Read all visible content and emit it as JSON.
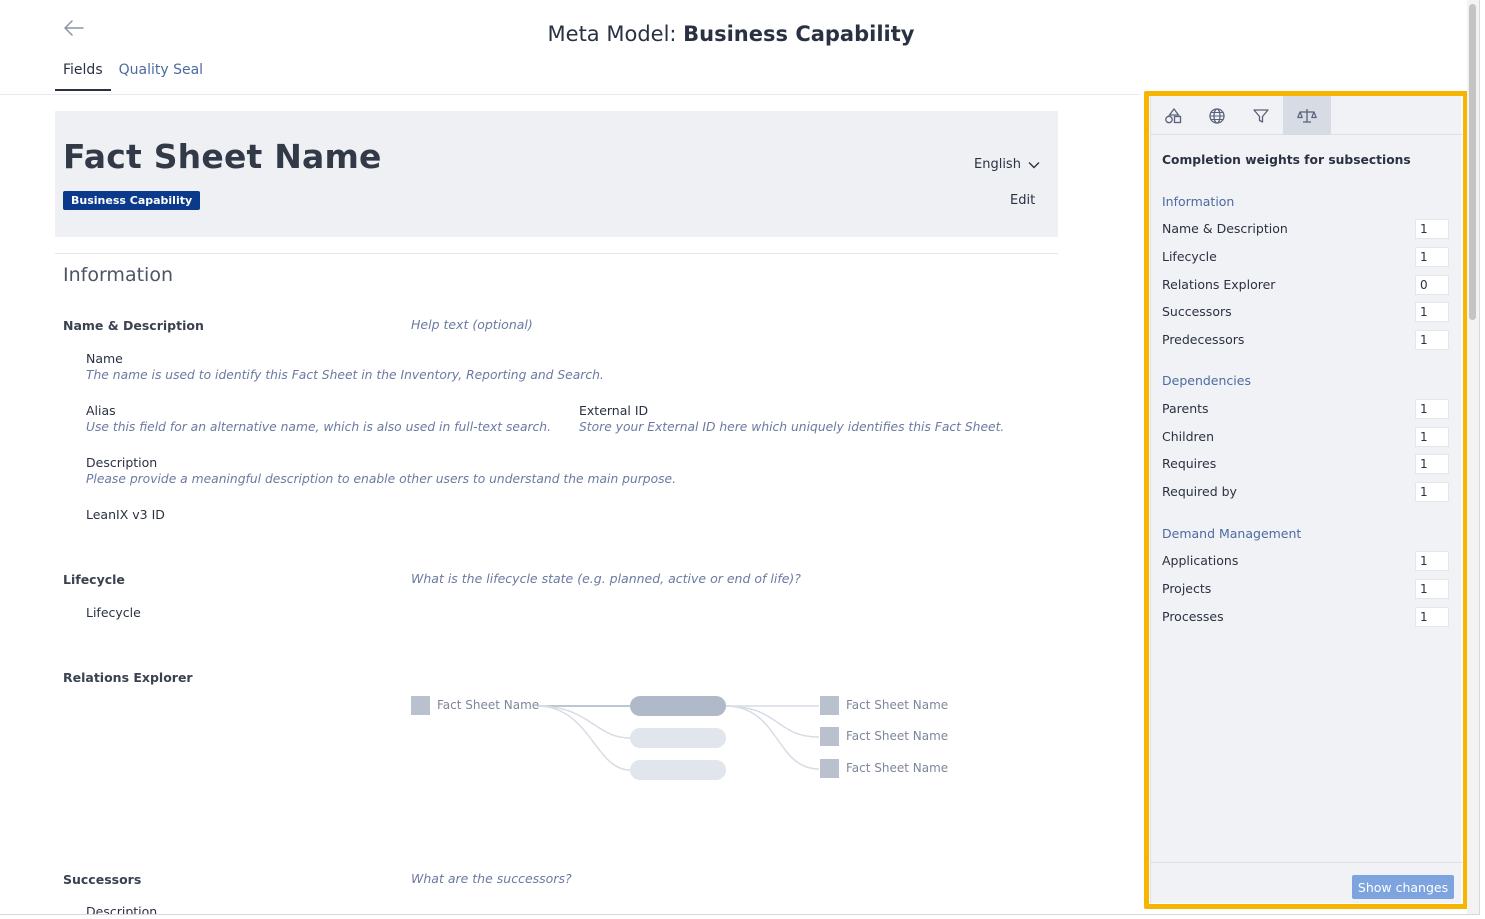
{
  "header": {
    "title_prefix": "Meta Model: ",
    "title_strong": "Business Capability",
    "tabs": [
      {
        "label": "Fields",
        "active": true
      },
      {
        "label": "Quality Seal",
        "active": false
      }
    ]
  },
  "card": {
    "fact_sheet_name": "Fact Sheet Name",
    "badge": "Business Capability",
    "language": "English",
    "edit_label": "Edit"
  },
  "information": {
    "title": "Information",
    "name_desc": {
      "title": "Name & Description",
      "help": "Help text (optional)",
      "fields": {
        "name": {
          "label": "Name",
          "desc": "The name is used to identify this Fact Sheet in the Inventory, Reporting and Search."
        },
        "alias": {
          "label": "Alias",
          "desc": "Use this field for an alternative name, which is also used in full-text search."
        },
        "external_id": {
          "label": "External ID",
          "desc": "Store your External ID here which uniquely identifies this Fact Sheet."
        },
        "description": {
          "label": "Description",
          "desc": "Please provide a meaningful description to enable other users to understand the main purpose."
        },
        "leanix_id": {
          "label": "LeanIX v3 ID"
        }
      }
    },
    "lifecycle": {
      "title": "Lifecycle",
      "help": "What is the lifecycle state (e.g. planned, active or end of life)?",
      "field": "Lifecycle"
    },
    "relations": {
      "title": "Relations Explorer",
      "source": "Fact Sheet Name",
      "targets": [
        "Fact Sheet Name",
        "Fact Sheet Name",
        "Fact Sheet Name"
      ]
    },
    "successors": {
      "title": "Successors",
      "help": "What are the successors?",
      "field": "Description"
    }
  },
  "panel": {
    "tabs": [
      {
        "icon": "shapes-icon",
        "active": false
      },
      {
        "icon": "globe-icon",
        "active": false
      },
      {
        "icon": "filter-icon",
        "active": false
      },
      {
        "icon": "scale-icon",
        "active": true
      }
    ],
    "title": "Completion weights for subsections",
    "groups": [
      {
        "name": "Information",
        "rows": [
          {
            "label": "Name & Description",
            "value": "1"
          },
          {
            "label": "Lifecycle",
            "value": "1"
          },
          {
            "label": "Relations Explorer",
            "value": "0"
          },
          {
            "label": "Successors",
            "value": "1"
          },
          {
            "label": "Predecessors",
            "value": "1"
          }
        ]
      },
      {
        "name": "Dependencies",
        "rows": [
          {
            "label": "Parents",
            "value": "1"
          },
          {
            "label": "Children",
            "value": "1"
          },
          {
            "label": "Requires",
            "value": "1"
          },
          {
            "label": "Required by",
            "value": "1"
          }
        ]
      },
      {
        "name": "Demand Management",
        "rows": [
          {
            "label": "Applications",
            "value": "1"
          },
          {
            "label": "Projects",
            "value": "1"
          },
          {
            "label": "Processes",
            "value": "1"
          }
        ]
      }
    ],
    "show_changes_label": "Show changes"
  },
  "colors": {
    "highlight": "#f7b400",
    "badge": "#0b3a8c",
    "link": "#4c6ba1",
    "button": "#7ea4e0"
  }
}
